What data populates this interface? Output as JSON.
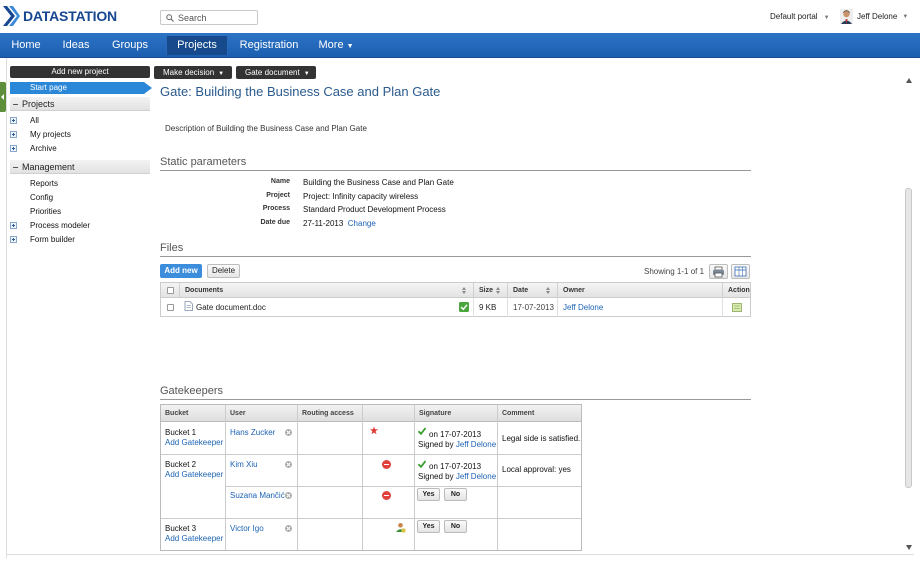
{
  "header": {
    "logo": "DATASTATION",
    "search_placeholder": "Search",
    "portal": "Default portal",
    "user": "Jeff Delone"
  },
  "nav": {
    "items": [
      "Home",
      "Ideas",
      "Groups",
      "Projects",
      "Registration",
      "More"
    ],
    "active": "Projects"
  },
  "toolbar": {
    "add_project": "Add new project",
    "make_decision": "Make decision",
    "gate_document": "Gate document"
  },
  "sidebar": {
    "start_page": "Start page",
    "projects_header": "Projects",
    "projects_items": [
      "All",
      "My projects",
      "Archive"
    ],
    "management_header": "Management",
    "management_items": [
      "Reports",
      "Config",
      "Priorities",
      "Process modeler",
      "Form builder"
    ]
  },
  "main": {
    "title": "Gate: Building the Business Case and Plan Gate",
    "description": "Description of Building the Business Case and Plan Gate",
    "static_header": "Static parameters",
    "params": {
      "name_label": "Name",
      "name_value": "Building the Business Case and Plan Gate",
      "project_label": "Project",
      "project_value": "Project: Infinity capacity wireless",
      "process_label": "Process",
      "process_value": "Standard Product Development Process",
      "date_label": "Date due",
      "date_value": "27-11-2013",
      "date_change": "Change"
    },
    "files_header": "Files",
    "files_add": "Add new",
    "files_delete": "Delete",
    "files_showing": "Showing 1-1 of 1",
    "files_columns": [
      "Documents",
      "Size",
      "Date",
      "Owner",
      "Action"
    ],
    "files_row": {
      "name": "Gate document.doc",
      "size": "9 KB",
      "date": "17-07-2013",
      "owner": "Jeff Delone"
    },
    "gatekeepers_header": "Gatekeepers",
    "gk_columns": [
      "Bucket",
      "User",
      "Routing access",
      "",
      "Signature",
      "Comment"
    ],
    "gk": {
      "b1": "Bucket 1",
      "b2": "Bucket 2",
      "b3": "Bucket 3",
      "add": "Add Gatekeeper",
      "u1": "Hans Zucker",
      "u2": "Kim Xiu",
      "u3": "Suzana Mančić",
      "u4": "Victor Igo",
      "sig_on": "on 17-07-2013",
      "signed_by": "Signed by",
      "signer": "Jeff Delone",
      "c1": "Legal side is satisfied.",
      "c2": "Local approval: yes",
      "yes": "Yes",
      "no": "No"
    }
  }
}
